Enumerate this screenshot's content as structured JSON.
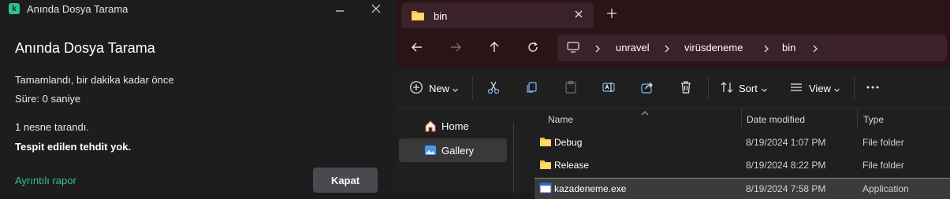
{
  "kaspersky": {
    "window_title": "Anında Dosya Tarama",
    "heading": "Anında Dosya Tarama",
    "status": "Tamamlandı, bir dakika kadar önce",
    "duration": "Süre: 0 saniye",
    "scanned": "1 nesne tarandı.",
    "result": "Tespit edilen tehdit yok.",
    "report_link": "Ayrıntılı rapor",
    "close_button": "Kapat",
    "logo_letter": "k",
    "accent_color": "#38c18f"
  },
  "explorer": {
    "tab_title": "bin",
    "breadcrumb": [
      "unravel",
      "virüsdeneme",
      "bin"
    ],
    "toolbar": {
      "new_label": "New",
      "sort_label": "Sort",
      "view_label": "View"
    },
    "nav_items": [
      {
        "label": "Home",
        "icon": "home-icon"
      },
      {
        "label": "Gallery",
        "icon": "gallery-icon",
        "selected": true
      }
    ],
    "columns": [
      "Name",
      "Date modified",
      "Type"
    ],
    "rows": [
      {
        "name": "Debug",
        "date": "8/19/2024 1:07 PM",
        "type": "File folder",
        "icon": "folder-icon"
      },
      {
        "name": "Release",
        "date": "8/19/2024 8:22 PM",
        "type": "File folder",
        "icon": "folder-icon"
      },
      {
        "name": "kazadeneme.exe",
        "date": "8/19/2024 7:58 PM",
        "type": "Application",
        "icon": "application-icon",
        "selected": true
      }
    ]
  }
}
